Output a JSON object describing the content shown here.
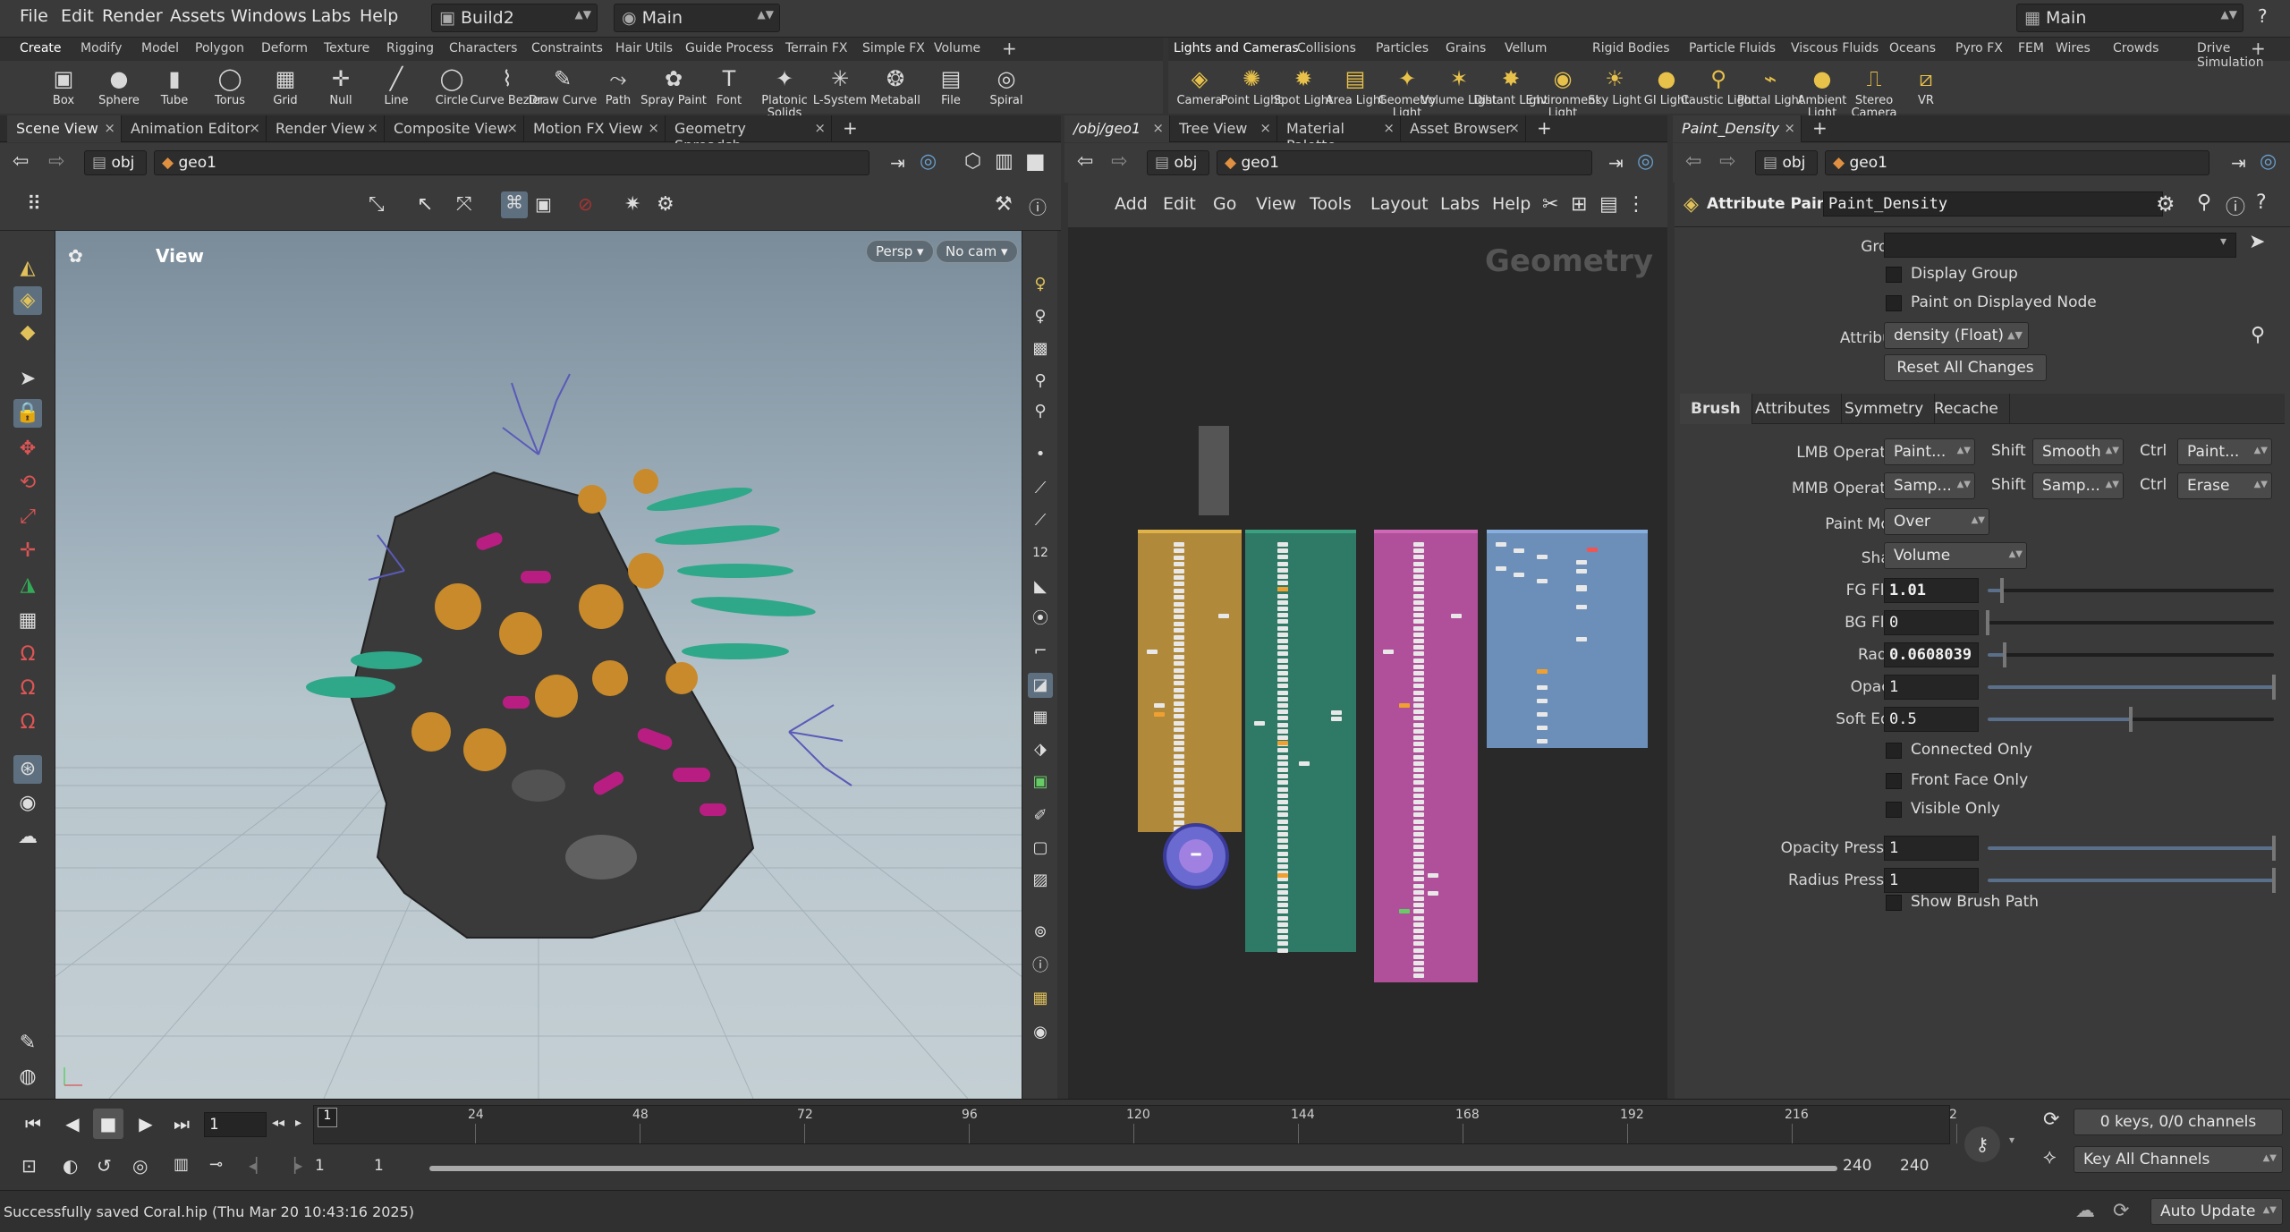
{
  "menubar": {
    "items": [
      "File",
      "Edit",
      "Render",
      "Assets",
      "Windows",
      "Labs",
      "Help"
    ],
    "desktop": "Build2",
    "network": "Main",
    "right_desktop": "Main"
  },
  "shelf_left": {
    "tabs": [
      "Create",
      "Modify",
      "Model",
      "Polygon",
      "Deform",
      "Texture",
      "Rigging",
      "Characters",
      "Constraints",
      "Hair Utils",
      "Guide Process",
      "Terrain FX",
      "Simple FX",
      "Volume"
    ],
    "tools": [
      "Box",
      "Sphere",
      "Tube",
      "Torus",
      "Grid",
      "Null",
      "Line",
      "Circle",
      "Curve Bezier",
      "Draw Curve",
      "Path",
      "Spray Paint",
      "Font",
      "Platonic Solids",
      "L-System",
      "Metaball",
      "File",
      "Spiral"
    ]
  },
  "shelf_right": {
    "tabs": [
      "Lights and Cameras",
      "Collisions",
      "Particles",
      "Grains",
      "Vellum",
      "Rigid Bodies",
      "Particle Fluids",
      "Viscous Fluids",
      "Oceans",
      "Pyro FX",
      "FEM",
      "Wires",
      "Crowds",
      "Drive Simulation"
    ],
    "tools": [
      "Camera",
      "Point Light",
      "Spot Light",
      "Area Light",
      "Geometry Light",
      "Volume Light",
      "Distant Light",
      "Environment Light",
      "Sky Light",
      "GI Light",
      "Caustic Light",
      "Portal Light",
      "Ambient Light",
      "Stereo Camera",
      "VR"
    ]
  },
  "left_tabs": [
    "Scene View",
    "Animation Editor",
    "Render View",
    "Composite View",
    "Motion FX View",
    "Geometry Spreadsh..."
  ],
  "mid_tabs": [
    "/obj/geo1",
    "Tree View",
    "Material Palette",
    "Asset Browser"
  ],
  "right_tabs": [
    "Paint_Density"
  ],
  "path": {
    "obj": "obj",
    "geo": "geo1"
  },
  "viewport": {
    "title": "View",
    "persp": "Persp",
    "cam": "No cam"
  },
  "network": {
    "menu": [
      "Add",
      "Edit",
      "Go",
      "View",
      "Tools",
      "Layout",
      "Labs",
      "Help"
    ],
    "context": "Geometry"
  },
  "params": {
    "node_type": "Attribute Paint",
    "node_name": "Paint_Density",
    "group_label": "Group",
    "group_value": "",
    "display_group": "Display Group",
    "paint_displayed": "Paint on Displayed Node",
    "attribute_label": "Attribute",
    "attribute_value": "density (Float)",
    "reset": "Reset All Changes",
    "subtabs": [
      "Brush",
      "Attributes",
      "Symmetry",
      "Recache"
    ],
    "lmb_label": "LMB Operation",
    "lmb": "Paint...",
    "shift": "Shift",
    "lmb_shift": "Smooth",
    "ctrl": "Ctrl",
    "lmb_ctrl": "Paint...",
    "mmb_label": "MMB Operation",
    "mmb": "Samp...",
    "mmb_shift": "Samp...",
    "mmb_ctrl": "Erase",
    "paint_mode_label": "Paint Mode",
    "paint_mode": "Over",
    "shape_label": "Shape",
    "shape": "Volume",
    "fg_label": "FG Float",
    "fg": "1.01",
    "fg_frac": 0.05,
    "bg_label": "BG Float",
    "bg": "0",
    "bg_frac": 0.0,
    "radius_label": "Radius",
    "radius": "0.0608039",
    "radius_frac": 0.06,
    "opacity_label": "Opacity",
    "opacity": "1",
    "opacity_frac": 1.0,
    "soft_label": "Soft Edge",
    "soft": "0.5",
    "soft_frac": 0.5,
    "connected": "Connected Only",
    "front": "Front Face Only",
    "visible": "Visible Only",
    "op_pressure_label": "Opacity Pressure",
    "op_pressure": "1",
    "op_pressure_frac": 1.0,
    "rad_pressure_label": "Radius Pressure",
    "rad_pressure": "1",
    "rad_pressure_frac": 1.0,
    "brush_path": "Show Brush Path"
  },
  "timeline": {
    "frame": "1",
    "ticks": [
      "24",
      "48",
      "72",
      "96",
      "120",
      "144",
      "168",
      "192",
      "216",
      "2"
    ],
    "start": "1",
    "start2": "1",
    "end": "240",
    "end2": "240",
    "keys": "0 keys, 0/0 channels",
    "key_all": "Key All Channels",
    "current": "1"
  },
  "status": {
    "message": "Successfully saved Coral.hip (Thu Mar 20 10:43:16 2025)",
    "update": "Auto Update"
  },
  "colors": {
    "accent": "#e0c15a",
    "box1": "#b08a3a",
    "box2": "#2f7a66",
    "box3": "#b04f9a",
    "box4": "#6b8fb8"
  }
}
